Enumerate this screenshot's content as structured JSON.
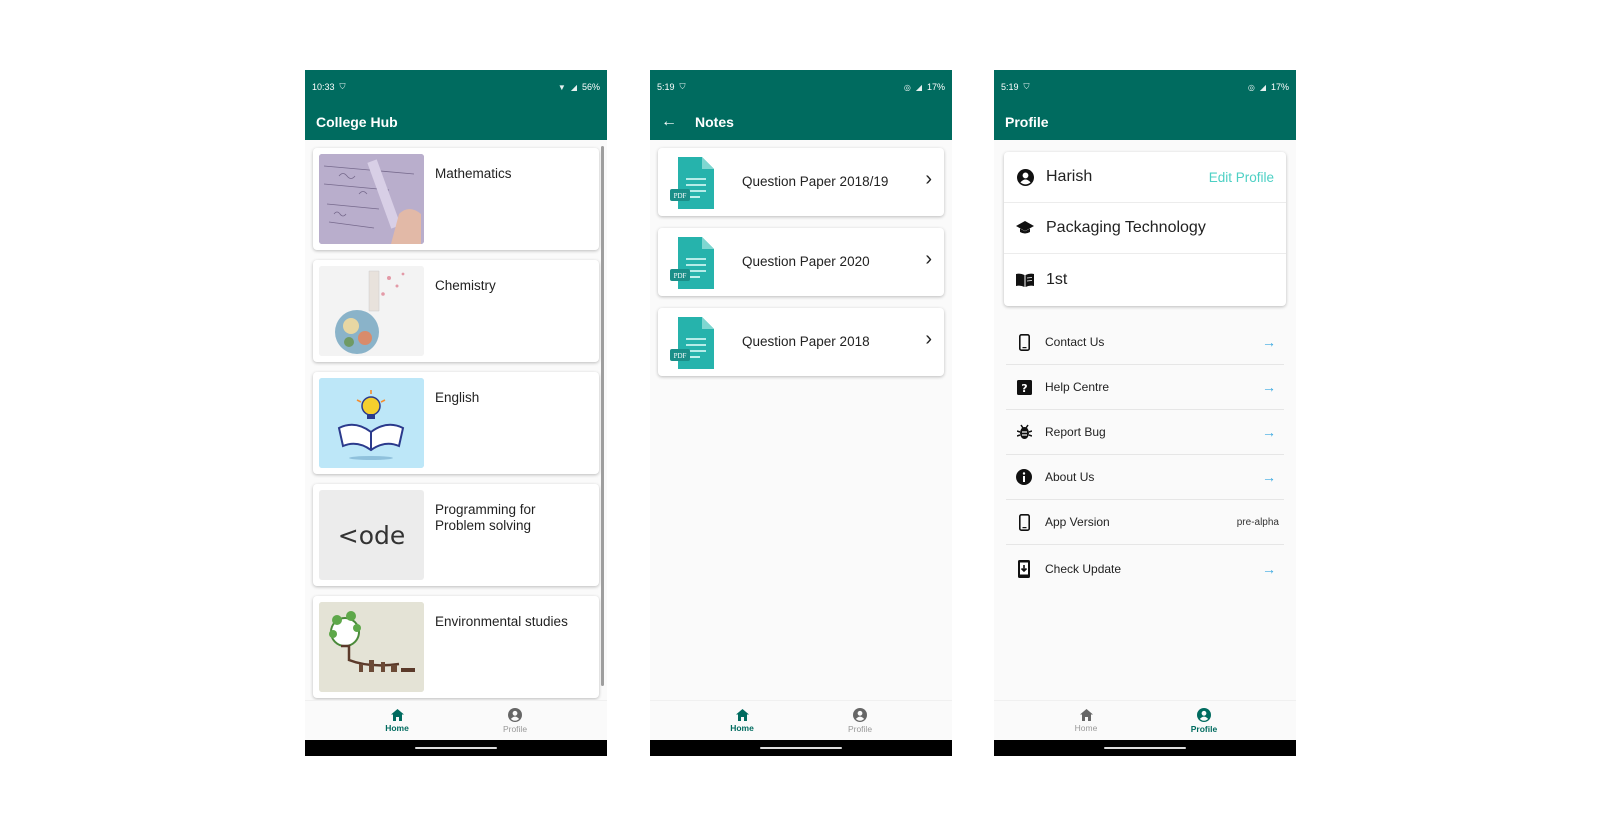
{
  "colors": {
    "primary": "#006b5f",
    "accent": "#4dd0c4",
    "arrow": "#3aa9e0"
  },
  "nav": {
    "home": "Home",
    "profile": "Profile"
  },
  "home": {
    "status": {
      "time": "10:33",
      "battery": "56%"
    },
    "title": "College Hub",
    "subjects": [
      {
        "title": "Mathematics",
        "icon": "math-photo"
      },
      {
        "title": "Chemistry",
        "icon": "flask-photo"
      },
      {
        "title": "English",
        "icon": "book-bulb-illustration"
      },
      {
        "title": "Programming for Problem solving",
        "icon": "code-logo",
        "logo_text": "<ode"
      },
      {
        "title": "Environmental studies",
        "icon": "green-bulb-illustration"
      }
    ]
  },
  "notes": {
    "status": {
      "time": "5:19",
      "battery": "17%"
    },
    "title": "Notes",
    "items": [
      {
        "title": "Question Paper 2018/19"
      },
      {
        "title": "Question Paper 2020"
      },
      {
        "title": "Question Paper 2018"
      }
    ],
    "pdf_label": "PDF"
  },
  "profile": {
    "status": {
      "time": "5:19",
      "battery": "17%"
    },
    "title": "Profile",
    "name": "Harish",
    "edit_label": "Edit Profile",
    "branch": "Packaging Technology",
    "year": "1st",
    "menu": [
      {
        "label": "Contact Us",
        "icon": "phone-icon"
      },
      {
        "label": "Help Centre",
        "icon": "help-icon"
      },
      {
        "label": "Report Bug",
        "icon": "bug-icon"
      },
      {
        "label": "About Us",
        "icon": "info-icon"
      },
      {
        "label": "App Version",
        "icon": "phone-icon",
        "value": "pre-alpha"
      },
      {
        "label": "Check Update",
        "icon": "system-update-icon"
      }
    ]
  }
}
